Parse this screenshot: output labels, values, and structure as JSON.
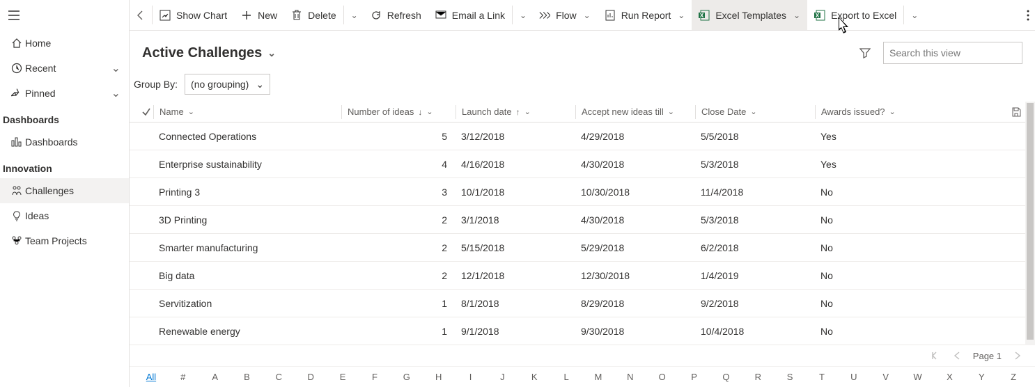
{
  "sidebar": {
    "home": "Home",
    "recent": "Recent",
    "pinned": "Pinned",
    "sections": {
      "dashboards_header": "Dashboards",
      "dashboards": "Dashboards",
      "innovation_header": "Innovation",
      "challenges": "Challenges",
      "ideas": "Ideas",
      "team_projects": "Team Projects"
    }
  },
  "cmdbar": {
    "show_chart": "Show Chart",
    "new": "New",
    "delete": "Delete",
    "refresh": "Refresh",
    "email_link": "Email a Link",
    "flow": "Flow",
    "run_report": "Run Report",
    "excel_templates": "Excel Templates",
    "export_excel": "Export to Excel"
  },
  "view": {
    "title": "Active Challenges",
    "search_placeholder": "Search this view",
    "group_by_label": "Group By:",
    "group_by_value": "(no grouping)"
  },
  "columns": {
    "name": "Name",
    "num_ideas": "Number of ideas",
    "launch": "Launch date",
    "accept": "Accept new ideas till",
    "close": "Close Date",
    "awards": "Awards issued?"
  },
  "rows": [
    {
      "name": "Connected Operations",
      "num": "5",
      "launch": "3/12/2018",
      "accept": "4/29/2018",
      "close": "5/5/2018",
      "awards": "Yes"
    },
    {
      "name": "Enterprise sustainability",
      "num": "4",
      "launch": "4/16/2018",
      "accept": "4/30/2018",
      "close": "5/3/2018",
      "awards": "Yes"
    },
    {
      "name": "Printing 3",
      "num": "3",
      "launch": "10/1/2018",
      "accept": "10/30/2018",
      "close": "11/4/2018",
      "awards": "No"
    },
    {
      "name": "3D Printing",
      "num": "2",
      "launch": "3/1/2018",
      "accept": "4/30/2018",
      "close": "5/3/2018",
      "awards": "No"
    },
    {
      "name": "Smarter manufacturing",
      "num": "2",
      "launch": "5/15/2018",
      "accept": "5/29/2018",
      "close": "6/2/2018",
      "awards": "No"
    },
    {
      "name": "Big data",
      "num": "2",
      "launch": "12/1/2018",
      "accept": "12/30/2018",
      "close": "1/4/2019",
      "awards": "No"
    },
    {
      "name": "Servitization",
      "num": "1",
      "launch": "8/1/2018",
      "accept": "8/29/2018",
      "close": "9/2/2018",
      "awards": "No"
    },
    {
      "name": "Renewable energy",
      "num": "1",
      "launch": "9/1/2018",
      "accept": "9/30/2018",
      "close": "10/4/2018",
      "awards": "No"
    }
  ],
  "pager": {
    "label": "Page 1"
  },
  "alpha": [
    "All",
    "#",
    "A",
    "B",
    "C",
    "D",
    "E",
    "F",
    "G",
    "H",
    "I",
    "J",
    "K",
    "L",
    "M",
    "N",
    "O",
    "P",
    "Q",
    "R",
    "S",
    "T",
    "U",
    "V",
    "W",
    "X",
    "Y",
    "Z"
  ]
}
